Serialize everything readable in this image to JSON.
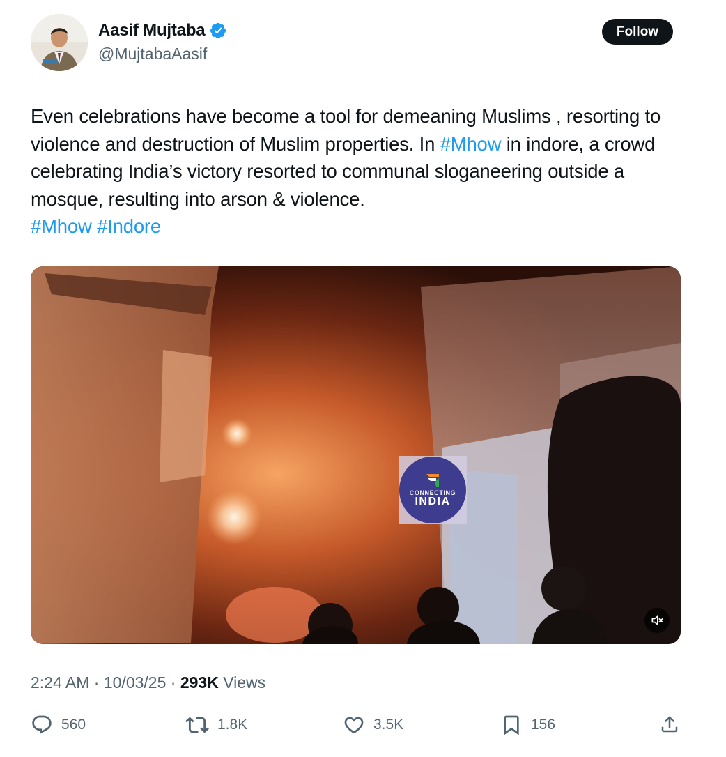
{
  "author": {
    "name": "Aasif Mujtaba",
    "handle": "@MujtabaAasif",
    "verified": true
  },
  "follow_label": "Follow",
  "tweet": {
    "text_parts": [
      "Even celebrations have become a tool for demeaning Muslims , resorting to violence and destruction of Muslim properties. In ",
      "#Mhow",
      " in indore, a crowd celebrating India’s victory resorted to communal sloganeering outside a mosque, resulting into arson & violence.",
      "#Mhow",
      "#Indore"
    ]
  },
  "media": {
    "watermark_line1": "CONNECTING",
    "watermark_line2": "INDIA",
    "mute_icon": "speaker-muted-icon"
  },
  "meta": {
    "time": "2:24 AM",
    "date": "10/03/25",
    "views_count": "293K",
    "views_label": "Views"
  },
  "actions": {
    "replies": "560",
    "reposts": "1.8K",
    "likes": "3.5K",
    "bookmarks": "156"
  },
  "colors": {
    "text": "#0f1419",
    "secondary": "#536471",
    "link": "#1d9bf0",
    "verified": "#1d9bf0"
  }
}
